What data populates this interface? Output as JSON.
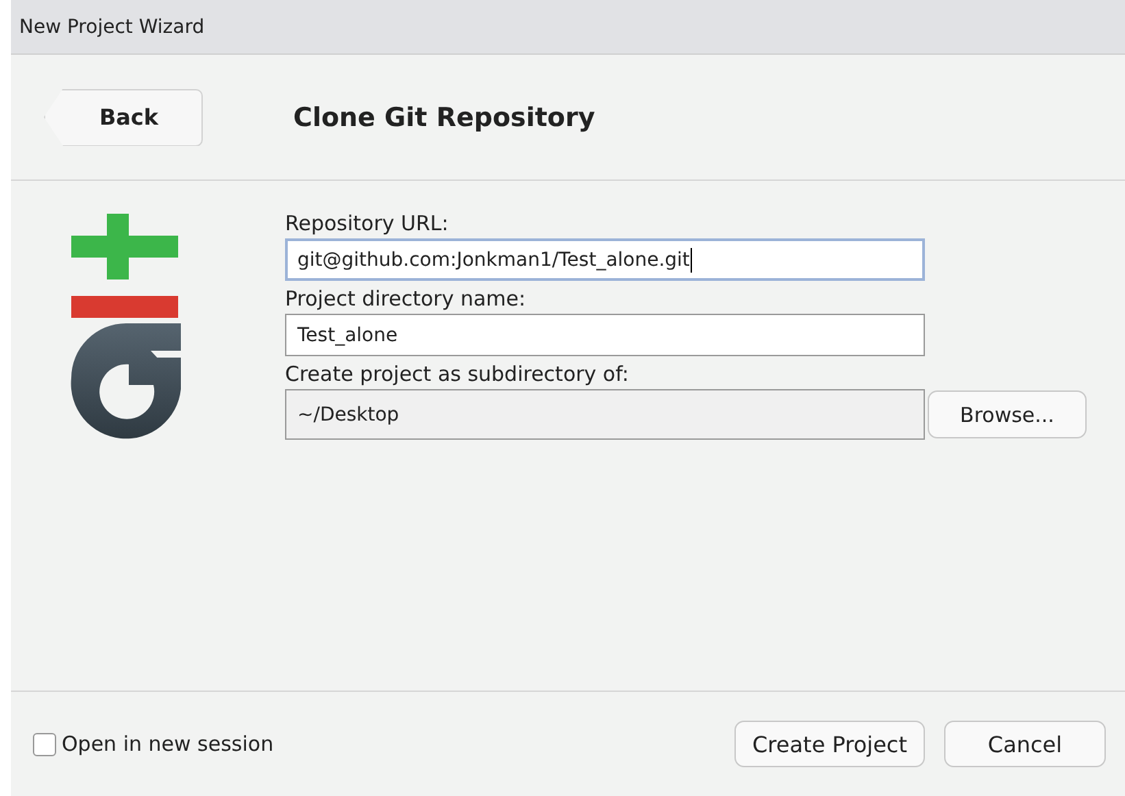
{
  "window": {
    "title": "New Project Wizard"
  },
  "header": {
    "back_button": "Back",
    "title": "Clone Git Repository"
  },
  "fields": [
    {
      "label": "Repository URL:",
      "value": "git@github.com:Jonkman1/Test_alone.git",
      "focused": true,
      "readonly": false
    },
    {
      "label": "Project directory name:",
      "value": "Test_alone",
      "focused": false,
      "readonly": false
    },
    {
      "label": "Create project as subdirectory of:",
      "value": "~/Desktop",
      "focused": false,
      "readonly": true,
      "button": "Browse..."
    }
  ],
  "footer": {
    "checkbox": {
      "label": "Open in new session",
      "checked": false
    },
    "buttons": [
      "Create Project",
      "Cancel"
    ]
  }
}
